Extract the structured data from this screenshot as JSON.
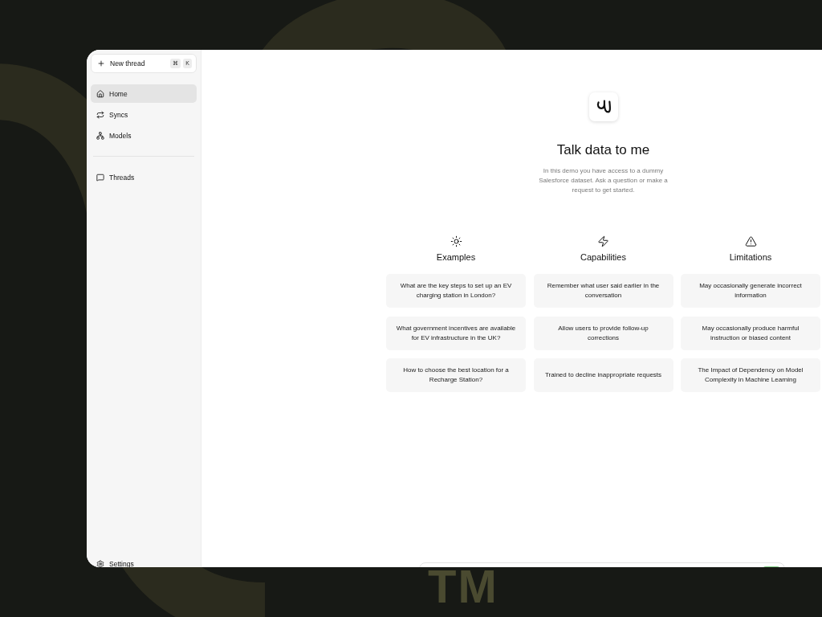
{
  "backdrop": {
    "mark": "TM"
  },
  "sidebar": {
    "new_thread": {
      "label": "New thread",
      "keys": [
        "⌘",
        "K"
      ]
    },
    "nav": [
      {
        "label": "Home",
        "selected": true
      },
      {
        "label": "Syncs",
        "selected": false
      },
      {
        "label": "Models",
        "selected": false
      }
    ],
    "threads": {
      "label": "Threads"
    },
    "settings": {
      "label": "Settings"
    }
  },
  "main": {
    "title": "Talk data to me",
    "description": "In this demo you have access to a dummy Salesforce dataset. Ask a question or make a request to get started.",
    "columns": [
      {
        "heading": "Examples",
        "cards": [
          "What are the key steps to set up an EV charging station in London?",
          "What government incentives are available for EV infrastructure in the UK?",
          "How to choose the best location for a Recharge Station?"
        ]
      },
      {
        "heading": "Capabilities",
        "cards": [
          "Remember what user said earlier in the conversation",
          "Allow users to provide follow-up corrections",
          "Trained to decline inappropriate requests"
        ]
      },
      {
        "heading": "Limitations",
        "cards": [
          "May occasionally generate incorrect information",
          "May occasionally produce harmful instruction or biased content",
          "The Impact of Dependency on Model Complexity in Machine Learning"
        ]
      }
    ]
  }
}
